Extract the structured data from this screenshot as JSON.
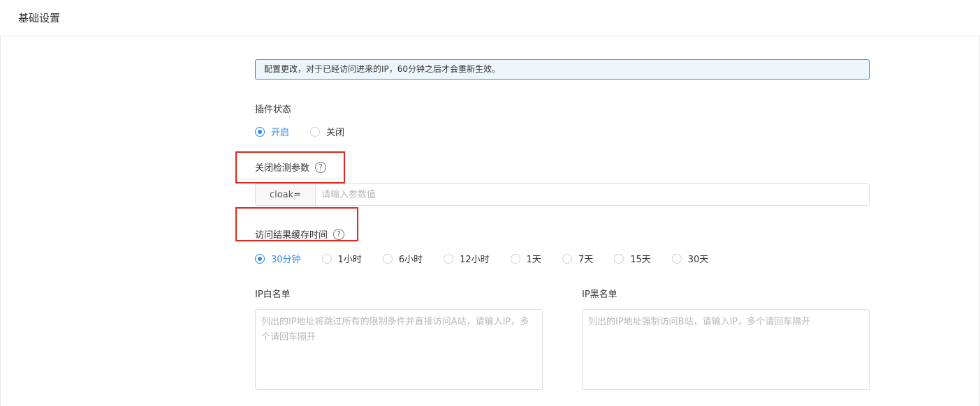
{
  "header": {
    "title": "基础设置"
  },
  "notice": {
    "text": "配置更改，对于已经访问进来的IP，60分钟之后才会重新生效。"
  },
  "plugin_status": {
    "label": "插件状态",
    "options": [
      {
        "label": "开启",
        "checked": true
      },
      {
        "label": "关闭",
        "checked": false
      }
    ]
  },
  "close_param": {
    "label": "关闭检测参数",
    "help": "?",
    "prefix": "cloak=",
    "placeholder": "请输入参数值",
    "value": ""
  },
  "cache_time": {
    "label": "访问结果缓存时间",
    "help": "?",
    "options": [
      {
        "label": "30分钟",
        "checked": true
      },
      {
        "label": "1小时",
        "checked": false
      },
      {
        "label": "6小时",
        "checked": false
      },
      {
        "label": "12小时",
        "checked": false
      },
      {
        "label": "1天",
        "checked": false
      },
      {
        "label": "7天",
        "checked": false
      },
      {
        "label": "15天",
        "checked": false
      },
      {
        "label": "30天",
        "checked": false
      }
    ]
  },
  "whitelist": {
    "label": "IP白名单",
    "placeholder": "列出的IP地址将跳过所有的限制条件并直接访问A站，请输入IP，多个请回车隔开"
  },
  "blacklist": {
    "label": "IP黑名单",
    "placeholder": "列出的IP地址强制访问B站，请输入IP，多个请回车隔开"
  },
  "colors": {
    "accent": "#2d8cf0",
    "highlight": "#e1251b",
    "notice_bg": "#eef6fc"
  }
}
